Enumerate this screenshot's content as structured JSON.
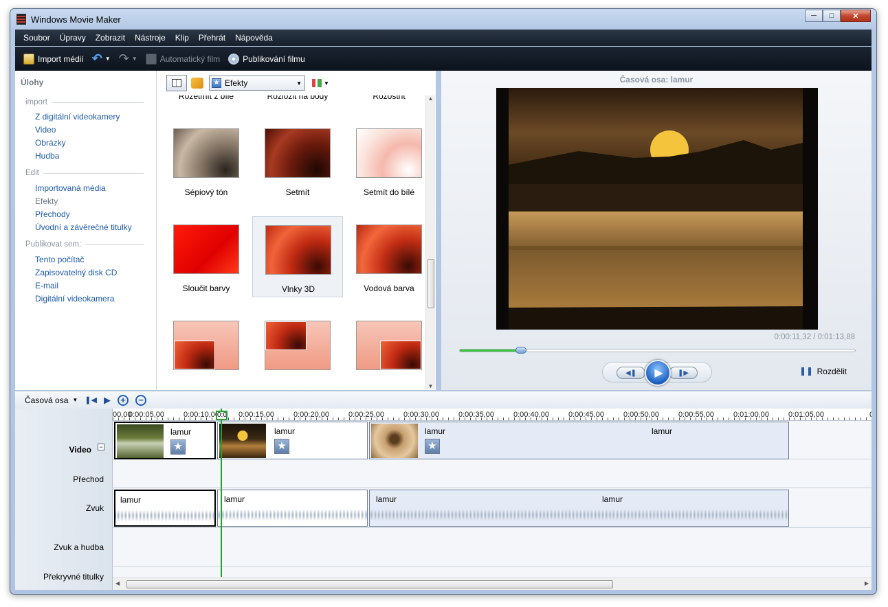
{
  "window": {
    "title": "Windows Movie Maker"
  },
  "menu": [
    "Soubor",
    "Úpravy",
    "Zobrazit",
    "Nástroje",
    "Klip",
    "Přehrát",
    "Nápověda"
  ],
  "toolbar": {
    "import": "Import médií",
    "autofilm": "Automatický film",
    "publish": "Publikování filmu"
  },
  "tasks": {
    "title": "Úlohy",
    "import_header": "import",
    "import_links": [
      "Z digitální videokamery",
      "Video",
      "Obrázky",
      "Hudba"
    ],
    "edit_header": "Edit",
    "edit_links": [
      "Importovaná média",
      "Efekty",
      "Přechody",
      "Úvodní a závěrečné titulky"
    ],
    "publish_header": "Publikovat sem:",
    "publish_links": [
      "Tento počítač",
      "Zapisovatelný disk CD",
      "E-mail",
      "Digitální videokamera"
    ]
  },
  "effects": {
    "dropdown": "Efekty",
    "items": [
      "Rozetmít z bílé",
      "Rozložit na body",
      "Rozostřit",
      "Sépiový tón",
      "Setmít",
      "Setmít do bílé",
      "Sloučit barvy",
      "Vlnky 3D",
      "Vodová barva",
      "",
      "",
      ""
    ],
    "selected": "Vlnky 3D"
  },
  "preview": {
    "title": "Časová osa: lamur",
    "timecode": "0:00:11,32 / 0:01:13,88",
    "progress": 0.154,
    "split": "Rozdělit"
  },
  "timeline": {
    "mode": "Časová osa",
    "ruler": [
      "00,00",
      "0:00:05,00",
      "0:00:10,00",
      "0:00:15,00",
      "0:00:20,00",
      "0:00:25,00",
      "0:00:30,00",
      "0:00:35,00",
      "0:00:40,00",
      "0:00:45,00",
      "0:00:50,00",
      "0:00:55,00",
      "0:01:00,00",
      "0:01:05,00",
      "0"
    ],
    "playhead_label": "0:00",
    "tracks": [
      "Video",
      "Přechod",
      "Zvuk",
      "Zvuk a hudba",
      "Překryvné titulky"
    ],
    "clip_name": "lamur"
  },
  "colors": {
    "accent": "#1d5aa8",
    "playhead": "#21a032",
    "menu_bg": "#16202c"
  },
  "icons": [
    "film-icon",
    "import-icon",
    "undo-icon",
    "redo-icon",
    "autofilm-icon",
    "publish-icon",
    "star-icon",
    "play-icon",
    "zoom-in-icon",
    "zoom-out-icon",
    "split-icon"
  ]
}
